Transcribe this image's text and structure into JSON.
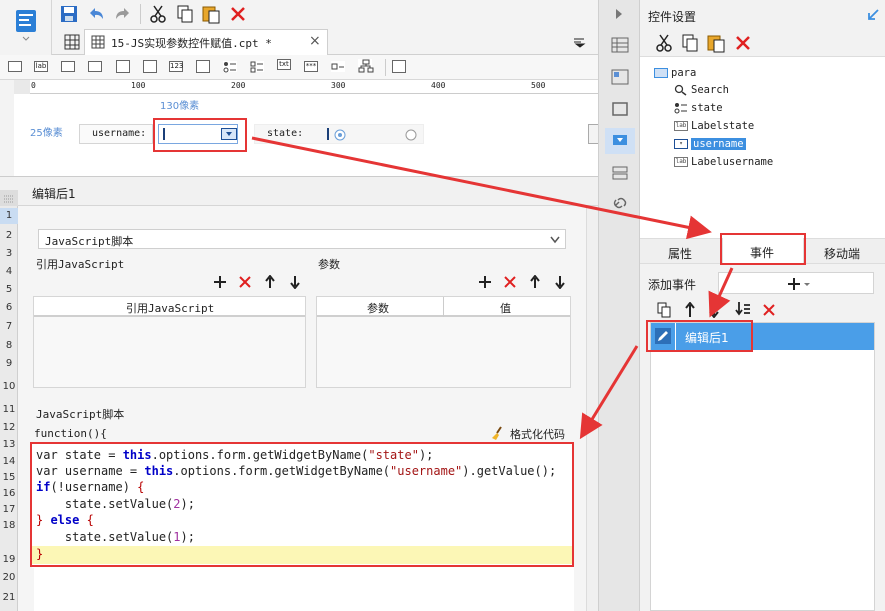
{
  "window": {
    "tab_title": "15-JS实现参数控件赋值.cpt *",
    "tab_close": "×"
  },
  "ruler": {
    "ticks": [
      "0",
      "100",
      "200",
      "300",
      "400",
      "500"
    ]
  },
  "canvas": {
    "width_annot": "130像素",
    "height_annot": "25像素",
    "username_label": "username:",
    "state_label": "state:"
  },
  "dialog": {
    "title": "编辑后1",
    "script_type": "JavaScript脚本",
    "ref_js_section": "引用JavaScript",
    "params_section": "参数",
    "ref_js_col": "引用JavaScript",
    "params_col": "参数",
    "value_col": "值",
    "script_section": "JavaScript脚本",
    "function_header": "function(){",
    "format_code": "格式化代码",
    "line_numbers": [
      "1",
      "2",
      "3",
      "4",
      "5",
      "6",
      "7",
      "8",
      "9",
      "10",
      "11",
      "12",
      "13",
      "14",
      "15",
      "16",
      "17",
      "18",
      "19",
      "20",
      "21"
    ],
    "code": {
      "l1_a": "var state = ",
      "l1_b": "this",
      "l1_c": ".options.form.getWidgetByName(",
      "l1_d": "\"state\"",
      "l1_e": ");",
      "l2_a": "var username = ",
      "l2_b": "this",
      "l2_c": ".options.form.getWidgetByName(",
      "l2_d": "\"username\"",
      "l2_e": ").getValue();",
      "l3_a": "if",
      "l3_b": "(!username) ",
      "l3_c": "{",
      "l4_a": "    state.setValue(",
      "l4_b": "2",
      "l4_c": ");",
      "l5_a": "}",
      "l5_b": " else ",
      "l5_c": "{",
      "l6_a": "    state.setValue(",
      "l6_b": "1",
      "l6_c": ");",
      "l7_a": "}"
    }
  },
  "right": {
    "widget_settings": "控件设置",
    "tree": {
      "root": "para",
      "items": [
        "Search",
        "state",
        "Labelstate",
        "username",
        "Labelusername"
      ]
    },
    "tabs": [
      "属性",
      "事件",
      "移动端"
    ],
    "add_event": "添加事件",
    "event_item": "编辑后1"
  },
  "colors": {
    "accent_blue": "#3c8fe0",
    "selection_blue": "#4a9ee8",
    "highlight_red": "#e53535",
    "code_highlight": "#fcf7b6"
  }
}
